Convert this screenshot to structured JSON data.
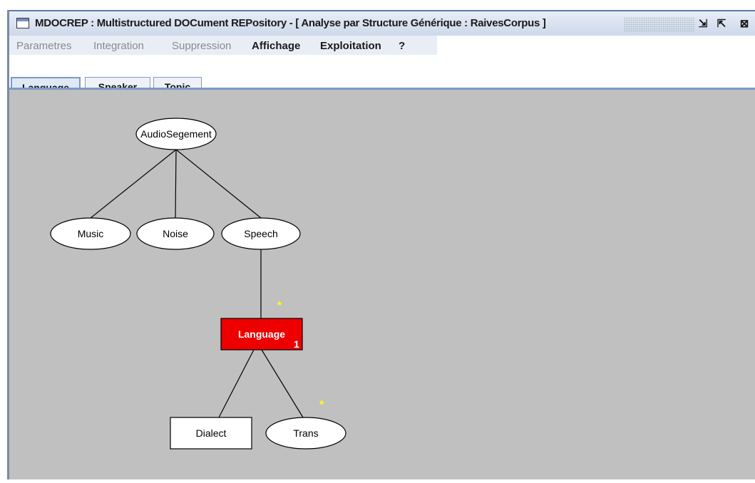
{
  "window": {
    "title": "MDOCREP : Multistructured DOCument REPository - [ Analyse par Structure Générique : RaivesCorpus ]",
    "buttons": [
      "⇲",
      "⇱",
      "⊠"
    ]
  },
  "menu": [
    {
      "label": "Parametres",
      "enabled": false
    },
    {
      "label": "Integration",
      "enabled": false
    },
    {
      "label": "Suppression",
      "enabled": false
    },
    {
      "label": "Affichage",
      "enabled": true
    },
    {
      "label": "Exploitation",
      "enabled": true
    },
    {
      "label": "?",
      "enabled": true
    }
  ],
  "tabs": [
    {
      "label": "Language",
      "active": true
    },
    {
      "label": "Speaker",
      "active": false
    },
    {
      "label": "Topic",
      "active": false
    }
  ],
  "tree": {
    "nodes": [
      {
        "id": "audiosegement",
        "label": "AudioSegement",
        "shape": "ellipse"
      },
      {
        "id": "music",
        "label": "Music",
        "shape": "ellipse"
      },
      {
        "id": "noise",
        "label": "Noise",
        "shape": "ellipse"
      },
      {
        "id": "speech",
        "label": "Speech",
        "shape": "ellipse"
      },
      {
        "id": "language",
        "label": "Language",
        "shape": "rect",
        "selected": true,
        "badge": "1"
      },
      {
        "id": "dialect",
        "label": "Dialect",
        "shape": "rect"
      },
      {
        "id": "trans",
        "label": "Trans",
        "shape": "ellipse"
      }
    ],
    "edges": [
      [
        "audiosegement",
        "music"
      ],
      [
        "audiosegement",
        "noise"
      ],
      [
        "audiosegement",
        "speech"
      ],
      [
        "speech",
        "language"
      ],
      [
        "language",
        "dialect"
      ],
      [
        "language",
        "trans"
      ]
    ],
    "markers": [
      {
        "text": "*",
        "near": "language"
      },
      {
        "text": "*",
        "near": "trans"
      }
    ]
  },
  "colors": {
    "selected_fill": "#ee0000",
    "marker": "#ffff00",
    "canvas": "#c0c0c0"
  }
}
